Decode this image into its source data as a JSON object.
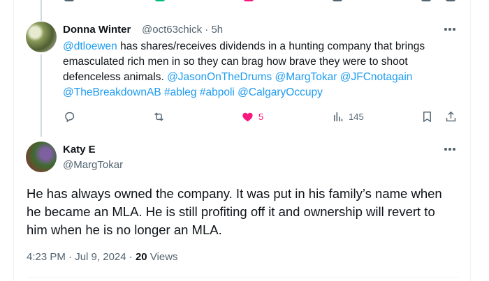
{
  "reply": {
    "name": "Donna Winter",
    "handle": "@oct63chick",
    "separator": "·",
    "time": "5h",
    "text": {
      "mention": "@dtloewen",
      "line1_rest": " has shares/receives dividends in a hunting company that brings",
      "line2": "emasculated rich men in so they can brag how brave they were to shoot",
      "line3_start": "defenceless animals. ",
      "tags_line3": [
        "@JasonOnTheDrums",
        "@MargTokar",
        "@JFCnotagain"
      ],
      "tags_line4": [
        "@TheBreakdownAB",
        "#ableg",
        "#abpoli",
        "@CalgaryOccupy"
      ]
    },
    "actions": {
      "reply_icon": "reply-icon",
      "retweet_icon": "retweet-icon",
      "like_icon": "heart-filled-icon",
      "likes": "5",
      "views_icon": "views-icon",
      "views": "145",
      "bookmark_icon": "bookmark-icon",
      "share_icon": "share-icon"
    }
  },
  "main": {
    "name": "Katy E",
    "handle": "@MargTokar",
    "text_line1": "He has always owned the company. It was put in his family’s name when",
    "text_line2": "he became an MLA. He is still profiting off it and ownership will revert to",
    "text_line3": "him when he is no longer an MLA.",
    "time": "4:23 PM",
    "dot": "·",
    "date": "Jul 9, 2024",
    "dot2": "·",
    "views_count": "20",
    "views_label": "Views"
  },
  "colors": {
    "accent": "#1d9bf0",
    "like": "#f91880",
    "secondary_text": "#536471",
    "primary_text": "#0f1419"
  }
}
